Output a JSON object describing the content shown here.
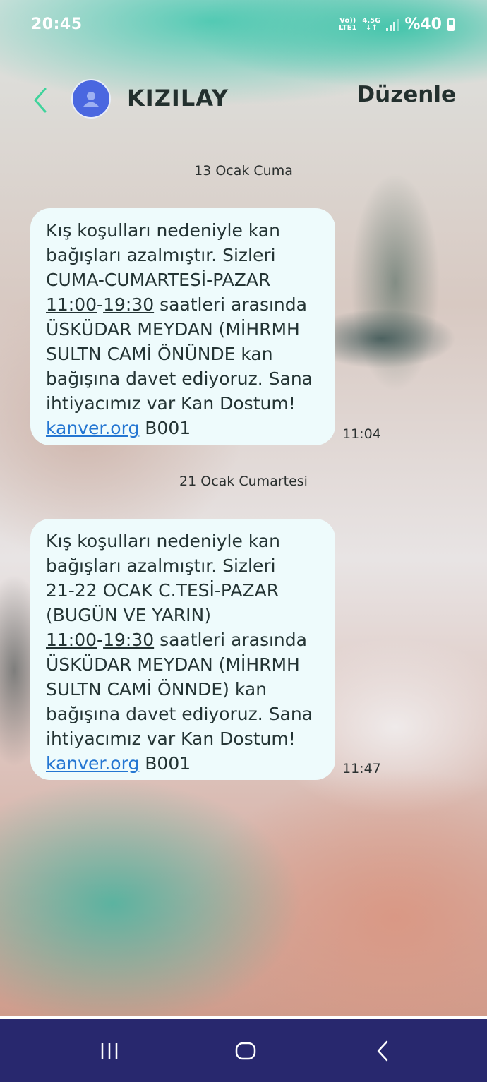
{
  "status_bar": {
    "time": "20:45",
    "network_top": "Vo))",
    "network_bottom": "LTE1",
    "network_type": "4.5G",
    "battery_percent": "%40",
    "battery_level": 0.4
  },
  "header": {
    "contact_name": "KIZILAY",
    "edit_label": "Düzenle",
    "back_icon": "chevron-left-icon",
    "avatar_icon": "person-icon",
    "avatar_color": "#4a67e0"
  },
  "conversation": {
    "groups": [
      {
        "date": "13 Ocak Cuma",
        "message": {
          "lines": [
            "Kış koşulları nedeniyle kan",
            "bağışları azalmıştır. Sizleri",
            "CUMA-CUMARTESİ-PAZAR"
          ],
          "hours_line": {
            "start": "11:00",
            "dash": "-",
            "end": "19:30",
            "rest": " saatleri arasında"
          },
          "lines_after": [
            "ÜSKÜDAR MEYDAN (MİHRMH",
            "SULTN CAMİ ÖNÜNDE kan",
            "bağışına davet ediyoruz. Sana",
            "ihtiyacımız var Kan Dostum!"
          ],
          "link": "kanver.org",
          "code": " B001",
          "time": "11:04"
        }
      },
      {
        "date": "21 Ocak Cumartesi",
        "message": {
          "lines": [
            "Kış koşulları nedeniyle kan",
            "bağışları azalmıştır. Sizleri",
            "21-22 OCAK C.TESİ-PAZAR",
            "(BUGÜN VE YARIN)"
          ],
          "hours_line": {
            "start": "11:00",
            "dash": "-",
            "end": "19:30",
            "rest": " saatleri arasında"
          },
          "lines_after": [
            "ÜSKÜDAR MEYDAN (MİHRMH",
            "SULTN CAMİ ÖNNDE) kan",
            "bağışına davet ediyoruz. Sana",
            "ihtiyacımız var Kan Dostum!"
          ],
          "link": "kanver.org",
          "code": " B001",
          "time": "11:47"
        }
      }
    ]
  },
  "nav_bar": {
    "background": "#28286e",
    "buttons": [
      "recent-apps-icon",
      "home-icon",
      "back-icon"
    ]
  },
  "theme": {
    "bubble_bg": "#eefbfc",
    "link_color": "#2476d2",
    "wallpaper_teal": "#40c4aa"
  }
}
